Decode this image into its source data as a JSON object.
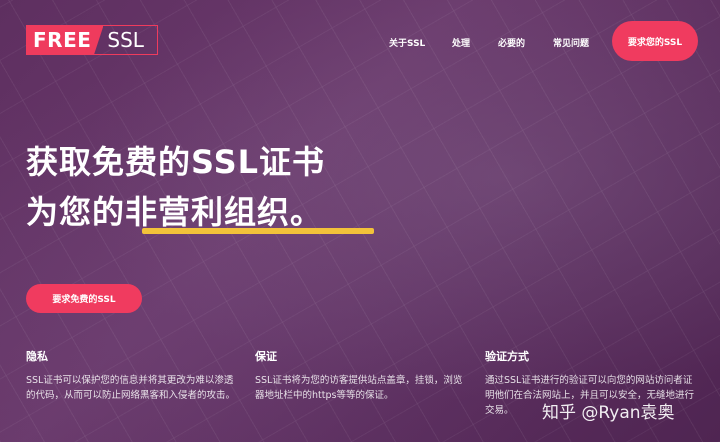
{
  "header": {
    "logo_free": "FREE",
    "logo_ssl": "SSL",
    "nav": [
      "关于SSL",
      "处理",
      "必要的",
      "常见问题"
    ],
    "cta": "要求您的SSL"
  },
  "hero": {
    "title_line1": "获取免费的SSL证书",
    "title_line2": "为您的非营利组织。",
    "cta": "要求免费的SSL"
  },
  "features": [
    {
      "title": "隐私",
      "text": "SSL证书可以保护您的信息并将其更改为难以渗透的代码，从而可以防止网络黑客和入侵者的攻击。"
    },
    {
      "title": "保证",
      "text": "SSL证书将为您的访客提供站点盖章，挂锁，浏览器地址栏中的https等等的保证。"
    },
    {
      "title": "验证方式",
      "text": "通过SSL证书进行的验证可以向您的网站访问者证明他们在合法网站上，并且可以安全，无缝地进行交易。"
    }
  ],
  "watermark": "知乎 @Ryan袁奥",
  "colors": {
    "accent": "#f03b5f",
    "underline": "#f2c23a",
    "background": "#5e2f60"
  }
}
